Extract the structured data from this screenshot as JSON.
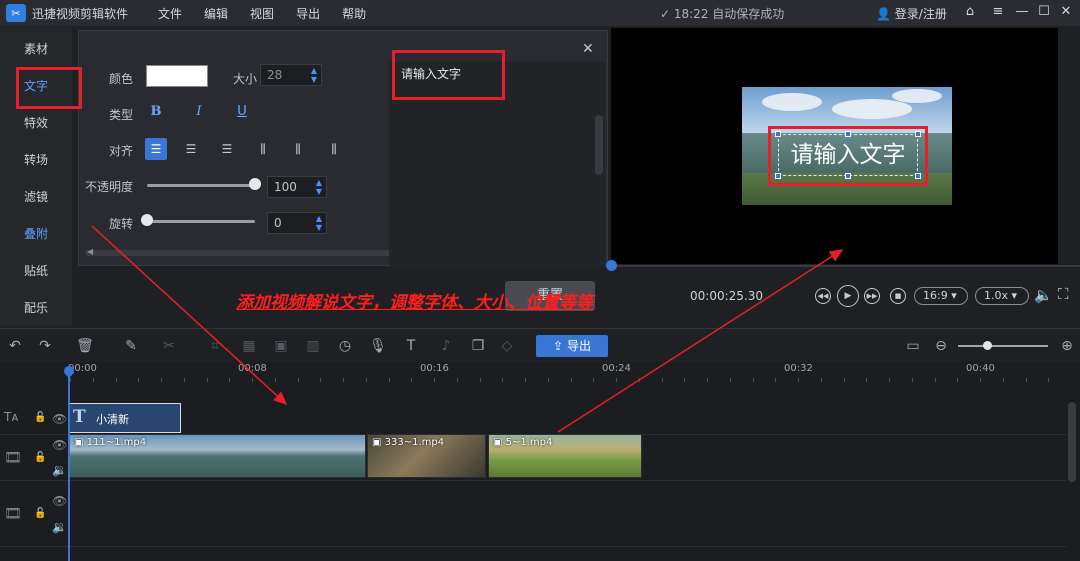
{
  "app": {
    "title": "迅捷视频剪辑软件",
    "logo_glyph": "✂"
  },
  "menu": [
    "文件",
    "编辑",
    "视图",
    "导出",
    "帮助"
  ],
  "status": {
    "autosave": "✓ 18:22 自动保存成功",
    "login": "登录/注册"
  },
  "sidebar": [
    "素材",
    "文字",
    "特效",
    "转场",
    "滤镜",
    "叠附",
    "贴纸",
    "配乐"
  ],
  "text_panel": {
    "color_label": "颜色",
    "size_label": "大小",
    "size_value": "28",
    "type_label": "类型",
    "bold": "B",
    "italic": "I",
    "underline": "U",
    "align_label": "对齐",
    "opacity_label": "不透明度",
    "opacity_value": "100",
    "rotate_label": "旋转",
    "rotate_value": "0",
    "input_text": "请输入文字",
    "opacity_level": 1.0,
    "rotate_level": 0.0
  },
  "preview": {
    "overlay_text": "请输入文字",
    "timecode": "00:00:25.30",
    "aspect": "16:9",
    "speed": "1.0x"
  },
  "annotation": {
    "caption": "添加视频解说文字，调整字体、大小、位置等等",
    "hidden_button": "重置"
  },
  "toolbar": {
    "export_label": "导出"
  },
  "ruler": [
    "00:00",
    "00:08",
    "00:16",
    "00:24",
    "00:32",
    "00:40"
  ],
  "tracks": {
    "text_clip": "小清新",
    "text_clip_icon": "T",
    "video_clips": [
      "111~1.mp4",
      "333~1.mp4",
      "5~1.mp4"
    ]
  },
  "colors": {
    "accent": "#3a76d6",
    "annotation": "#e5202a"
  }
}
